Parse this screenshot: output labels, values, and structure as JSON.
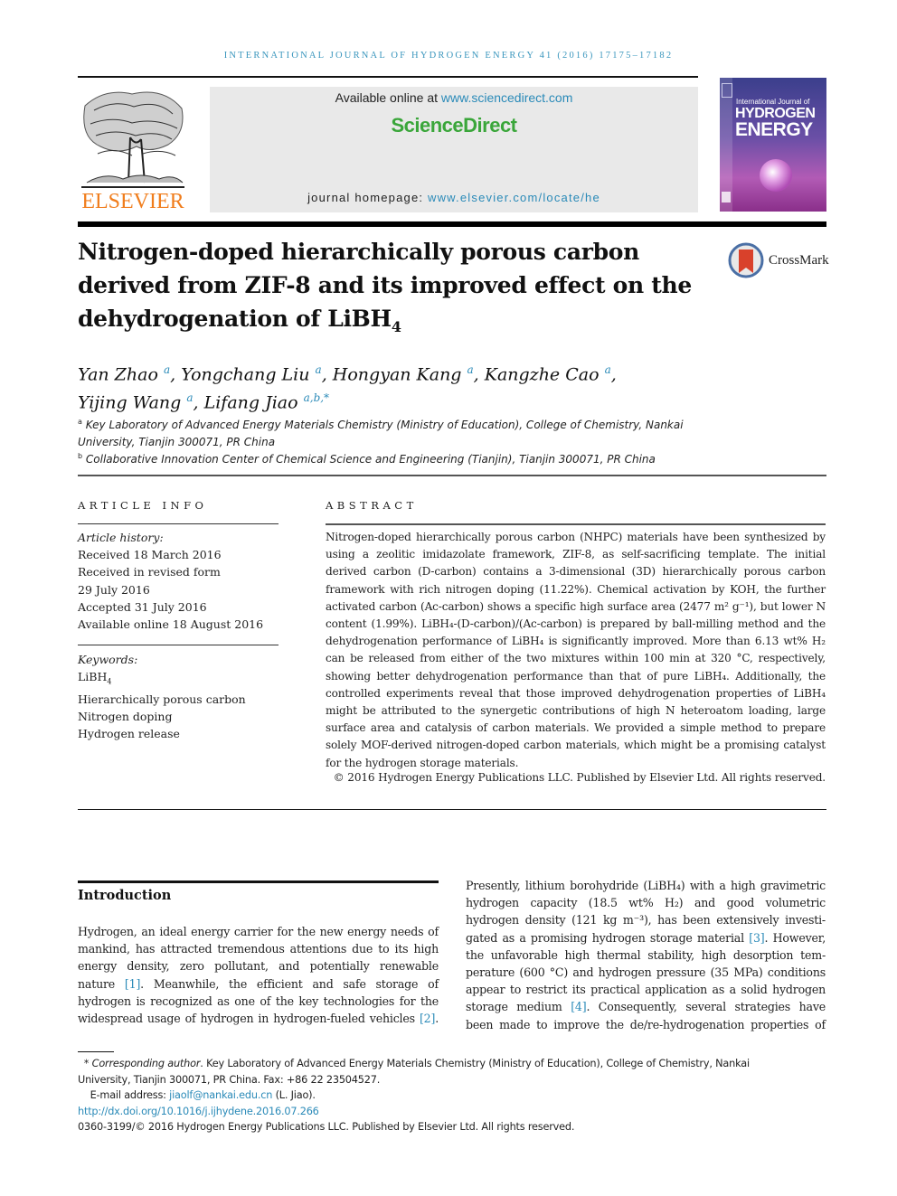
{
  "header": {
    "running_title": "INTERNATIONAL JOURNAL OF HYDROGEN ENERGY 41 (2016) 17175–17182",
    "publisher_logo_text": "ELSEVIER",
    "available_online_prefix": "Available online at ",
    "available_online_link": "www.sciencedirect.com",
    "sciencedirect_logo": "ScienceDirect",
    "homepage_prefix": "journal homepage: ",
    "homepage_link": "www.elsevier.com/locate/he",
    "cover": {
      "line1": "International Journal of",
      "line2": "HYDROGEN",
      "line3": "ENERGY"
    }
  },
  "article": {
    "title_line1": "Nitrogen-doped hierarchically porous carbon",
    "title_line2": "derived from ZIF-8 and its improved effect on the",
    "title_line3_pre": "dehydrogenation of LiBH",
    "title_line3_sub": "4",
    "crossmark_label": "CrossMark",
    "authors": [
      {
        "name": "Yan Zhao",
        "aff": "a",
        "sep": ", "
      },
      {
        "name": "Yongchang Liu",
        "aff": "a",
        "sep": ", "
      },
      {
        "name": "Hongyan Kang",
        "aff": "a",
        "sep": ", "
      },
      {
        "name": "Kangzhe Cao",
        "aff": "a",
        "sep": ","
      },
      {
        "name": "Yijing Wang",
        "aff": "a",
        "sep": ", "
      },
      {
        "name": "Lifang Jiao",
        "aff": "a,b,*",
        "sep": ""
      }
    ],
    "affiliations": [
      {
        "mark": "a",
        "line1": "Key Laboratory of Advanced Energy Materials Chemistry (Ministry of Education), College of Chemistry, Nankai",
        "line2": "University, Tianjin 300071, PR China"
      },
      {
        "mark": "b",
        "line1": "Collaborative Innovation Center of Chemical Science and Engineering (Tianjin), Tianjin 300071, PR China"
      }
    ]
  },
  "article_info": {
    "heading": "ARTICLE INFO",
    "history_label": "Article history:",
    "history": [
      "Received 18 March 2016",
      "Received in revised form",
      "29 July 2016",
      "Accepted 31 July 2016",
      "Available online 18 August 2016"
    ],
    "keywords_label": "Keywords:",
    "keywords": [
      "LiBH4",
      "Hierarchically porous carbon",
      "Nitrogen doping",
      "Hydrogen release"
    ]
  },
  "abstract": {
    "heading": "ABSTRACT",
    "lines": [
      "Nitrogen-doped hierarchically porous carbon (NHPC) materials have been synthesized by",
      "using a zeolitic imidazolate framework, ZIF-8, as self-sacrificing template. The initial",
      "derived carbon (D-carbon) contains a 3-dimensional (3D) hierarchically porous carbon",
      "framework with rich nitrogen doping (11.22%). Chemical activation by KOH, the further",
      "activated carbon (Ac-carbon) shows a specific high surface area (2477 m² g⁻¹), but lower N",
      "content (1.99%). LiBH₄-(D-carbon)/(Ac-carbon) is prepared by ball-milling method and the",
      "dehydrogenation performance of LiBH₄ is significantly improved. More than 6.13 wt% H₂",
      "can be released from either of the two mixtures within 100 min at 320 °C, respectively,",
      "showing better dehydrogenation performance than that of pure LiBH₄. Additionally, the",
      "controlled experiments reveal that those improved dehydrogenation properties of LiBH₄",
      "might be attributed to the synergetic contributions of high N heteroatom loading, large",
      "surface area and catalysis of carbon materials. We provided a simple method to prepare",
      "solely MOF-derived nitrogen-doped carbon materials, which might be a promising catalyst",
      "for the hydrogen storage materials."
    ],
    "copyright": "© 2016 Hydrogen Energy Publications LLC. Published by Elsevier Ltd. All rights reserved."
  },
  "introduction": {
    "heading": "Introduction",
    "left_col": [
      {
        "text": "Hydrogen, an ideal energy carrier for the new energy needs of"
      },
      {
        "text": "mankind, has attracted tremendous attentions due to its high"
      },
      {
        "text": "energy density, zero pollutant, and potentially renewable"
      },
      {
        "pre": "nature ",
        "ref": "[1]",
        "post": ". Meanwhile, the efficient and safe storage of"
      },
      {
        "text": "hydrogen is recognized as one of the key technologies for the"
      },
      {
        "pre": "widespread usage of hydrogen in hydrogen-fueled vehicles ",
        "ref": "[2]",
        "post": "."
      }
    ],
    "right_col": [
      {
        "text": "Presently, lithium borohydride (LiBH₄) with a high gravimetric"
      },
      {
        "text": "hydrogen capacity (18.5 wt% H₂) and good volumetric"
      },
      {
        "text": "hydrogen density (121 kg m⁻³), has been extensively investi-"
      },
      {
        "pre": "gated as a promising hydrogen storage material ",
        "ref": "[3]",
        "post": ". However,"
      },
      {
        "text": "the unfavorable high thermal stability, high desorption tem-"
      },
      {
        "text": "perature (600 °C) and hydrogen pressure (35 MPa) conditions"
      },
      {
        "text": "appear to restrict its practical application as a solid hydrogen"
      },
      {
        "pre": "storage medium ",
        "ref": "[4]",
        "post": ". Consequently, several strategies have"
      },
      {
        "text": "been made to improve the de/re-hydrogenation properties of"
      }
    ]
  },
  "footnotes": {
    "corr_mark": "* ",
    "corr_label": "Corresponding author",
    "corr_line1": ". Key Laboratory of Advanced Energy Materials Chemistry (Ministry of Education), College of Chemistry, Nankai",
    "corr_line2": "University, Tianjin 300071, PR China. Fax: +86 22 23504527.",
    "email_prefix": "E-mail address: ",
    "email": "jiaolf@nankai.edu.cn",
    "email_suffix": " (L. Jiao).",
    "doi": "http://dx.doi.org/10.1016/j.ijhydene.2016.07.266",
    "issn_copyright": "0360-3199/© 2016 Hydrogen Energy Publications LLC. Published by Elsevier Ltd. All rights reserved."
  },
  "colors": {
    "link": "#2a8ab8",
    "elsevier_orange": "#f07d1c",
    "sciencedirect_green": "#3aa63a",
    "header_box": "#e9e9e9"
  }
}
